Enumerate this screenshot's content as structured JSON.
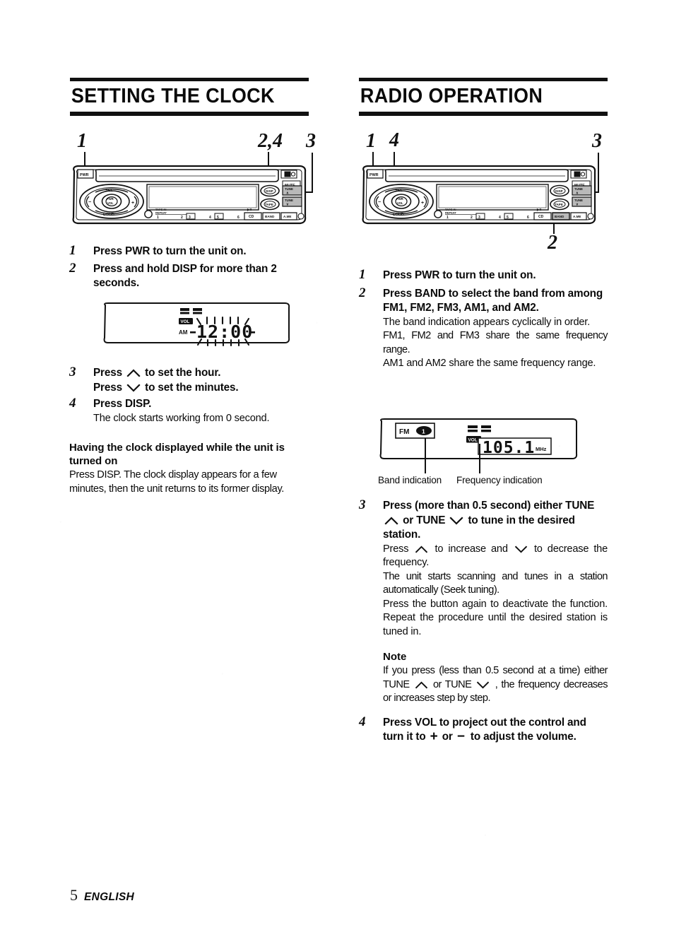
{
  "page": {
    "number": "5",
    "language": "ENGLISH"
  },
  "left_column": {
    "heading": "SETTING THE CLOCK",
    "callouts": [
      {
        "label": "1"
      },
      {
        "label": "2,4"
      },
      {
        "label": "3"
      }
    ],
    "steps": [
      {
        "num": "1",
        "bold": "Press PWR to turn the unit on."
      },
      {
        "num": "2",
        "bold": "Press and hold DISP for more than 2 seconds."
      },
      {
        "num": "3",
        "bold_a": "Press",
        "bold_a_end": "to set the hour.",
        "bold_b": "Press",
        "bold_b_end": "to set the minutes."
      },
      {
        "num": "4",
        "bold": "Press DISP.",
        "plain": "The clock starts working from 0 second."
      }
    ],
    "subsection": {
      "heading": "Having the clock displayed while the unit is turned on",
      "body": "Press DISP. The clock display appears for a few minutes, then the unit returns to its former display."
    },
    "clock_display": {
      "am_label": "AM",
      "vol_label": "VOL",
      "time": "12:00"
    }
  },
  "right_column": {
    "heading": "RADIO OPERATION",
    "callouts": [
      {
        "label": "1"
      },
      {
        "label": "4"
      },
      {
        "label": "3"
      },
      {
        "label": "2"
      }
    ],
    "steps": [
      {
        "num": "1",
        "bold": "Press PWR to turn the unit on."
      },
      {
        "num": "2",
        "bold": "Press BAND to select the band from among FM1, FM2, FM3, AM1, and AM2.",
        "plain_1": "The band indication appears cyclically in order.",
        "plain_2": "FM1, FM2 and FM3 share the same frequency range.",
        "plain_3": "AM1 and AM2 share the same frequency range."
      },
      {
        "num": "3",
        "bold_a": "Press (more than 0.5 second) either TUNE",
        "bold_b": "or TUNE",
        "bold_c": "to tune in the desired station.",
        "plain_a": "Press",
        "plain_b": "to increase and",
        "plain_c": "to decrease the frequency.",
        "plain_2": "The unit starts scanning and tunes in a station automatically (Seek tuning).",
        "plain_3": "Press the button again to deactivate the function. Repeat the procedure until the desired station is tuned in."
      },
      {
        "num": "4",
        "bold_a": "Press VOL to project out the control and turn it to",
        "bold_or": "or",
        "bold_b": "to adjust the volume.",
        "plus": "+",
        "minus": "−"
      }
    ],
    "note": {
      "heading": "Note",
      "text_a": "If you press (less than 0.5 second at a time) either TUNE",
      "text_b": "or TUNE",
      "text_c": ", the frequency decreases or increases step by step."
    },
    "radio_display": {
      "band": "FM",
      "band_number": "1",
      "vol_label": "VOL",
      "frequency": "105.1",
      "unit": "MHz",
      "caption_band": "Band indication",
      "caption_frequency": "Frequency indication"
    }
  },
  "faceplate": {
    "labels": {
      "pwr": "PWR",
      "mute": "MUTE",
      "sel": "SEL",
      "loud": "LOUD",
      "vol_center": "PWR VOL",
      "minus": "−",
      "plus": "+",
      "disp": "DISP",
      "tape": "TAPE",
      "tune_up": "TUNE",
      "tune_down": "TUNE",
      "cd": "CD",
      "band": "BAND",
      "ame": "A.ME",
      "tape_in": "TAPE IN",
      "repeat": "REPEAT",
      "eject": "EJECT",
      "presets": [
        "1",
        "2",
        "3",
        "4",
        "5",
        "6"
      ]
    }
  },
  "colors": {
    "ink": "#111111",
    "paper": "#ffffff"
  }
}
